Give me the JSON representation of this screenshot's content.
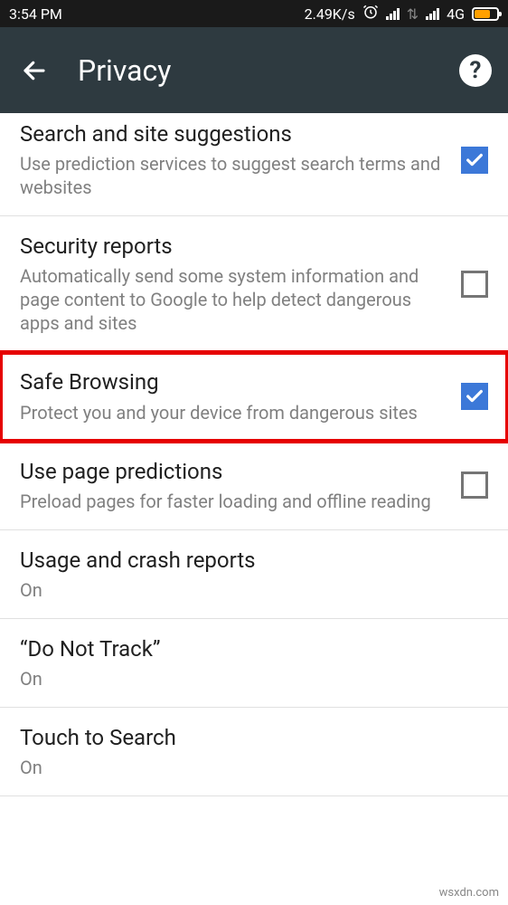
{
  "status": {
    "time": "3:54 PM",
    "speed": "2.49K/s",
    "network": "4G"
  },
  "header": {
    "title": "Privacy"
  },
  "items": [
    {
      "title": "Search and site suggestions",
      "sub": "Use prediction services to suggest search terms and websites",
      "checked": true,
      "highlight": false,
      "has_checkbox": true
    },
    {
      "title": "Security reports",
      "sub": "Automatically send some system information and page content to Google to help detect dangerous apps and sites",
      "checked": false,
      "highlight": false,
      "has_checkbox": true
    },
    {
      "title": "Safe Browsing",
      "sub": "Protect you and your device from dangerous sites",
      "checked": true,
      "highlight": true,
      "has_checkbox": true
    },
    {
      "title": "Use page predictions",
      "sub": "Preload pages for faster loading and offline reading",
      "checked": false,
      "highlight": false,
      "has_checkbox": true
    },
    {
      "title": "Usage and crash reports",
      "sub": "On",
      "checked": false,
      "highlight": false,
      "has_checkbox": false
    },
    {
      "title": "“Do Not Track”",
      "sub": "On",
      "checked": false,
      "highlight": false,
      "has_checkbox": false
    },
    {
      "title": "Touch to Search",
      "sub": "On",
      "checked": false,
      "highlight": false,
      "has_checkbox": false
    }
  ],
  "watermark": "wsxdn.com"
}
